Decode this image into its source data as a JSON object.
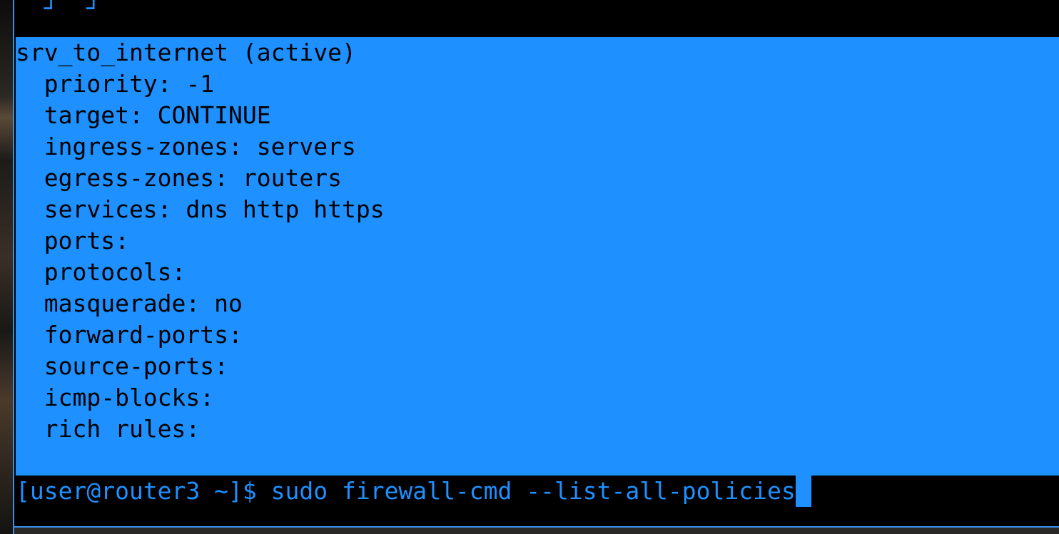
{
  "terminal": {
    "clipped_top_line": "  ┘  ┘",
    "selected_output": [
      "srv_to_internet (active)",
      "  priority: -1",
      "  target: CONTINUE",
      "  ingress-zones: servers",
      "  egress-zones: routers",
      "  services: dns http https",
      "  ports: ",
      "  protocols: ",
      "  masquerade: no",
      "  forward-ports: ",
      "  source-ports: ",
      "  icmp-blocks: ",
      "  rich rules: "
    ],
    "prompt": "[user@router3 ~]$ ",
    "command": "sudo firewall-cmd --list-all-policies",
    "colors": {
      "background": "#000000",
      "foreground": "#1e90ff",
      "selection": "#1e90ff",
      "selected_text": "#000000",
      "border": "#3b8fe8"
    }
  }
}
